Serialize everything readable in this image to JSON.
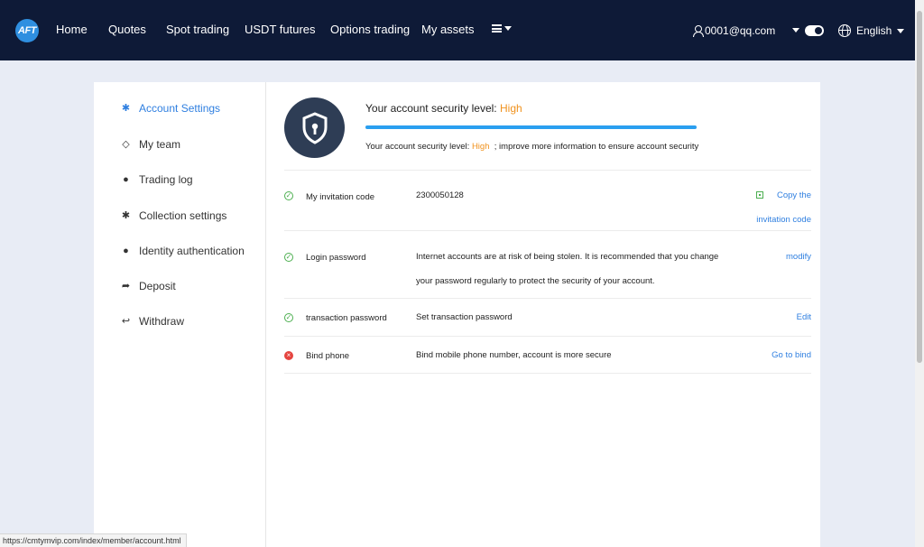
{
  "nav": {
    "logo_text": "AFT",
    "items": [
      "Home",
      "Quotes",
      "Spot trading",
      "USDT futures",
      "Options trading",
      "My assets"
    ],
    "user_email": "0001@qq.com",
    "language": "English"
  },
  "sidebar": {
    "items": [
      {
        "label": "Account Settings",
        "icon": "gear-icon"
      },
      {
        "label": "My team",
        "icon": "diamond-icon"
      },
      {
        "label": "Trading log",
        "icon": "circle-icon"
      },
      {
        "label": "Collection settings",
        "icon": "gear-icon"
      },
      {
        "label": "Identity authentication",
        "icon": "user-icon"
      },
      {
        "label": "Deposit",
        "icon": "share-icon"
      },
      {
        "label": "Withdraw",
        "icon": "reply-icon"
      }
    ]
  },
  "security": {
    "title_prefix": "Your account security level:",
    "level": "High",
    "progress": 1.0,
    "desc_prefix": "Your account security level:",
    "desc_level": "High",
    "desc_suffix": "; improve more information to ensure account security"
  },
  "rows": [
    {
      "status": "ok",
      "label": "My invitation code",
      "desc": "2300050128",
      "action": "Copy the invitation code"
    },
    {
      "status": "ok",
      "label": "Login password",
      "desc": "Internet accounts are at risk of being stolen. It is recommended that you change your password regularly to protect the security of your account.",
      "action": "modify"
    },
    {
      "status": "ok",
      "label": "transaction password",
      "desc": "Set transaction password",
      "action": "Edit"
    },
    {
      "status": "bad",
      "label": "Bind phone",
      "desc": "Bind mobile phone number, account is more secure",
      "action": "Go to bind"
    }
  ],
  "status_url": "https://cmtymvip.com/index/member/account.html",
  "colors": {
    "nav_bg": "#0e1a37",
    "accent": "#2f7fe0",
    "level": "#f0921e",
    "progress": "#2a9ff0"
  }
}
